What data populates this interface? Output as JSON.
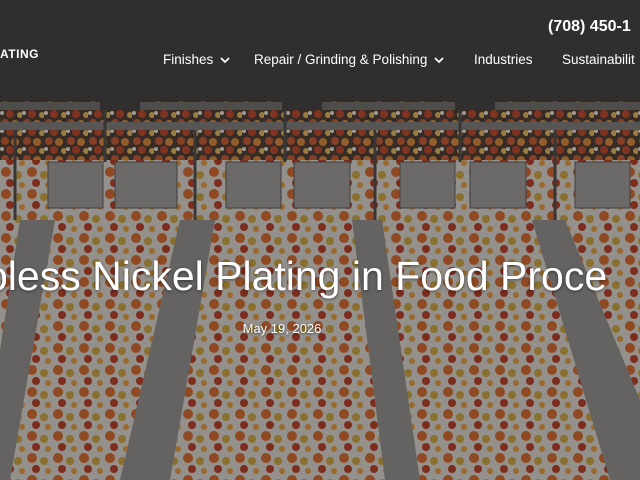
{
  "header": {
    "logo_text": "ATING",
    "phone": "(708) 450-1"
  },
  "nav": {
    "items": [
      {
        "label": "Finishes",
        "has_dropdown": true
      },
      {
        "label": "Repair / Grinding & Polishing",
        "has_dropdown": true
      },
      {
        "label": "Industries",
        "has_dropdown": false
      },
      {
        "label": "Sustainabilit",
        "has_dropdown": false
      }
    ]
  },
  "hero": {
    "title": "oless Nickel Plating in Food Proce",
    "date": "May 19, 2026"
  },
  "colors": {
    "header_bg": "#2f2f2f",
    "text": "#ffffff",
    "conveyor": "#8f8f8c"
  }
}
